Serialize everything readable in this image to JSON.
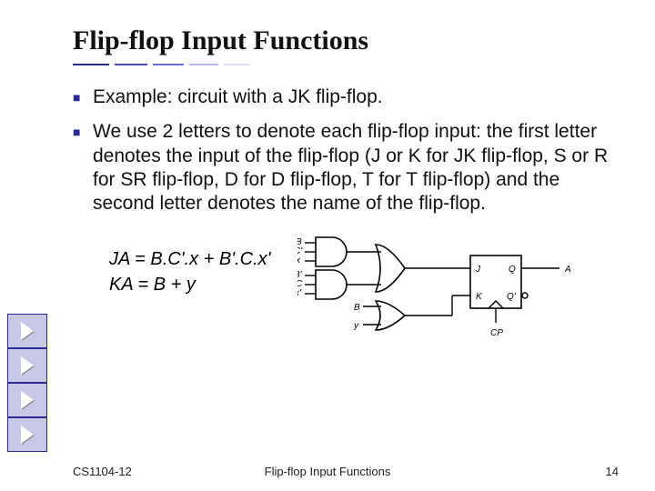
{
  "title": "Flip-flop Input Functions",
  "bullets": [
    "Example: circuit with a JK flip-flop.",
    "We use 2 letters to denote each flip-flop input: the first letter denotes the input of the flip-flop (J or K for JK flip-flop, S or R for SR flip-flop, D for D flip-flop, T for T flip-flop) and the second letter denotes the name of the flip-flop."
  ],
  "equations": {
    "ja": "JA = B.C'.x + B'.C.x'",
    "ka": "KA = B + y"
  },
  "circuit": {
    "and1_inputs": [
      "B",
      "C'",
      "x"
    ],
    "and2_inputs": [
      "B'",
      "C",
      "x'"
    ],
    "or2_inputs": [
      "B",
      "y"
    ],
    "ff_inputs": [
      "J",
      "K"
    ],
    "ff_outputs": [
      "Q",
      "Q'"
    ],
    "output_label": "A",
    "clock_label": "CP"
  },
  "footer": {
    "course": "CS1104-12",
    "title": "Flip-flop Input Functions",
    "page": "14"
  }
}
